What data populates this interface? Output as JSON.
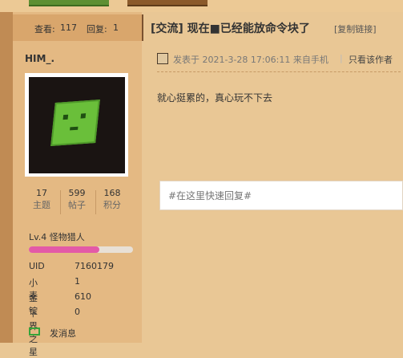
{
  "thread": {
    "stats": {
      "views_label": "查看:",
      "views": "117",
      "replies_label": "回复:",
      "replies": "1"
    },
    "title": "[交流] 现在■已经能放命令块了",
    "copy_link": "[复制链接]"
  },
  "user": {
    "name": "HIM_.",
    "stats": [
      {
        "value": "17",
        "label": "主题"
      },
      {
        "value": "599",
        "label": "帖子"
      },
      {
        "value": "168",
        "label": "积分"
      }
    ],
    "level": "Lv.4 怪物猎人",
    "level_progress": 0.68,
    "info": [
      {
        "key": "UID",
        "value": "7160179"
      },
      {
        "key": "小麦",
        "value": "1"
      },
      {
        "key": "金锭",
        "value": "610"
      },
      {
        "key": "下界之星",
        "value": "0"
      }
    ],
    "send_message": "发消息"
  },
  "post": {
    "meta": "发表于 2021-3-28 17:06:11 来自手机",
    "only_author": "只看该作者",
    "content": "就心挺累的，真心玩不下去"
  },
  "reply_box": {
    "placeholder": "#在这里快速回复#"
  },
  "colors": {
    "accent_red": "#e0462f",
    "level_bar": "#e35aa7",
    "message_icon": "#36a33a"
  }
}
